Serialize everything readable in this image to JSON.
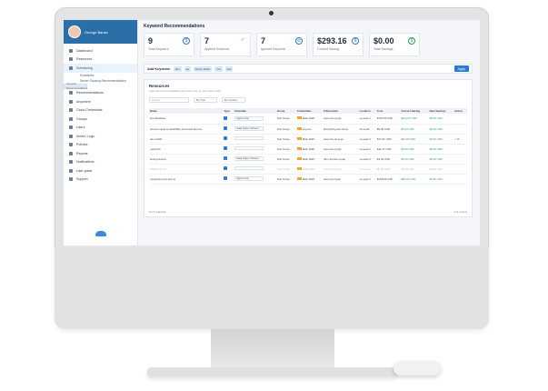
{
  "user": {
    "name": "George Banks"
  },
  "sidebar": {
    "items": [
      {
        "label": "Dashboard",
        "active": false
      },
      {
        "label": "Resources",
        "active": false
      },
      {
        "label": "Scheduling",
        "active": true
      }
    ],
    "sub": [
      "Schedules",
      "Server Pausing Recommendations",
      "Keyword Recommendations"
    ],
    "items2": [
      "Recommendations",
      "Anywhere",
      "Cloud Credentials",
      "Groups",
      "Users",
      "Alerts / Logs",
      "Policies",
      "Reports",
      "Notifications",
      "User guide",
      "Support"
    ]
  },
  "page": {
    "title": "Keyword Recommendations"
  },
  "cards": [
    {
      "value": "9",
      "label": "Total Keyword",
      "icon": "$"
    },
    {
      "value": "7",
      "label": "Applied Keyword",
      "icon": "✓"
    },
    {
      "value": "7",
      "label": "Ignored Keyword",
      "icon": "⊘"
    },
    {
      "value": "$293.16",
      "label": "Current Saving",
      "icon": "$"
    },
    {
      "value": "$0.00",
      "label": "Total Savings",
      "icon": "$"
    }
  ],
  "keyword": {
    "label": "Add Keyword:",
    "tags": [
      "dev",
      "qa",
      "Demo Poller",
      "uat",
      "test"
    ],
    "apply": "Apply"
  },
  "resources": {
    "title": "Resources",
    "subtitle": "Apply the recommendations and save more on your cloud costs",
    "search_placeholder": "Search",
    "filter1": "By Type",
    "filter2": "By Location",
    "headers": [
      "Name",
      "Type",
      "Schedule",
      "Group",
      "Credentials",
      "Information",
      "Location",
      "Cost",
      "Current Saving",
      "New Savings",
      "Action"
    ],
    "rows": [
      [
        "lion-Windows",
        "",
        "Apps temp",
        "Test Group",
        "Main AWS",
        "account-nyu(a)",
        "us-east-2",
        "$700.53 USD",
        "$114.07 USD",
        "$0.00 USD",
        ""
      ],
      [
        "aurora-mysql-compatibility-promoted-dev-lee",
        "",
        "Gate Super School",
        "Test Group",
        "Anyuno",
        "Everything test cloud",
        "uk-south",
        "$0.00 USD",
        "$0.00 USD",
        "$0.00 USD",
        ""
      ],
      [
        "dev-tool01",
        "",
        "",
        "Test Group",
        "Main AWS",
        "account-yang-qa",
        "us-east-2",
        "$71.62 USD",
        "$11.20 USD",
        "$0.00 USD",
        "✓ ⊘"
      ],
      [
        "marcoAh",
        "",
        "",
        "Test Group",
        "Main AWS",
        "account-nyu(a)",
        "us-east-2",
        "$11.47 USD",
        "$0.00 USD",
        "$0.00 USD",
        ""
      ],
      [
        "testing-aurora",
        "",
        "Gate Super School",
        "Test Group",
        "Main AWS",
        "db-1 aurora-nyu(a)",
        "us-east-2",
        "$1.64 USD",
        "$0.00 USD",
        "$0.00 USD",
        ""
      ],
      [
        "NGINX-AUTH",
        "",
        "",
        "Test Group",
        "Main AWS",
        "account-nyu(a)",
        "us-east-2",
        "$0.00 USD",
        "$0.00 USD",
        "$0.00 USD",
        ""
      ],
      [
        "mysql-dev-test-inst-vp",
        "",
        "Apps temp",
        "Test Group",
        "Main AWS",
        "account-mysql",
        "us-east-2",
        "$158.66 USD",
        "$63.22 USD",
        "$0.00 USD",
        ""
      ]
    ],
    "footer_left": "6 of 7 selected",
    "footer_right": "1 of 4 items"
  }
}
